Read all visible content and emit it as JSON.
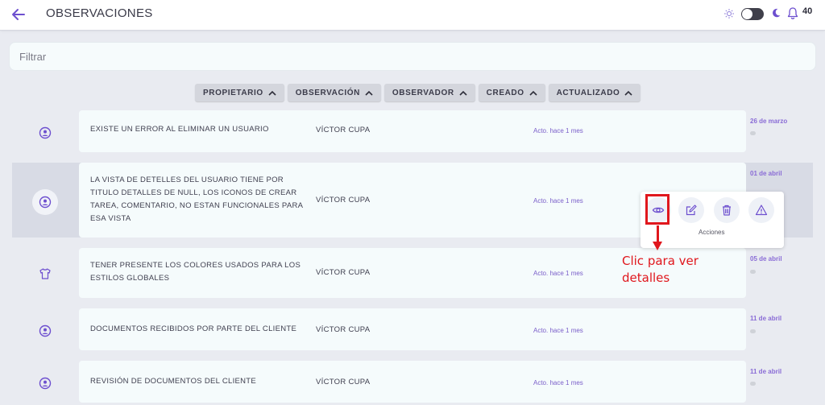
{
  "header": {
    "title": "OBSERVACIONES",
    "notification_count": "40"
  },
  "filter": {
    "placeholder": "Filtrar"
  },
  "sort_columns": [
    "PROPIETARIO",
    "OBSERVACIÓN",
    "OBSERVADOR",
    "CREADO",
    "ACTUALIZADO"
  ],
  "rows": [
    {
      "icon": "user-circle-icon",
      "observation": "EXISTE UN ERROR AL ELIMINAR UN USUARIO",
      "observer": "VÍCTOR CUPA",
      "updated": "Acto. hace 1 mes",
      "date": "26 de marzo"
    },
    {
      "icon": "user-circle-icon",
      "observation": "LA VISTA DE DETELLES DEL USUARIO TIENE POR TITULO DETALLES DE NULL, LOS ICONOS DE CREAR TAREA, COMENTARIO, NO ESTAN FUNCIONALES PARA ESA VISTA",
      "observer": "VÍCTOR CUPA",
      "updated": "Acto. hace 1 mes",
      "date": "01 de abril"
    },
    {
      "icon": "shirt-icon",
      "observation": "TENER PRESENTE LOS COLORES USADOS PARA LOS ESTILOS GLOBALES",
      "observer": "VÍCTOR CUPA",
      "updated": "Acto. hace 1 mes",
      "date": "05 de abril"
    },
    {
      "icon": "user-circle-icon",
      "observation": "DOCUMENTOS RECIBIDOS POR PARTE DEL CLIENTE",
      "observer": "VÍCTOR CUPA",
      "updated": "Acto. hace 1 mes",
      "date": "11 de abril"
    },
    {
      "icon": "user-circle-icon",
      "observation": "REVISIÓN DE DOCUMENTOS DEL CLIENTE",
      "observer": "VÍCTOR CUPA",
      "updated": "Acto. hace 1 mes",
      "date": "11 de abril"
    }
  ],
  "actions": {
    "label": "Acciones",
    "buttons": [
      "eye-icon",
      "edit-icon",
      "trash-icon",
      "warning-icon"
    ]
  },
  "annotation": {
    "text": "Clic para ver detalles"
  },
  "colors": {
    "accent": "#7a5ec9",
    "annotation": "#e0171d",
    "card_bg": "#f5fbfc",
    "highlight_row": "#d8dbe5"
  }
}
